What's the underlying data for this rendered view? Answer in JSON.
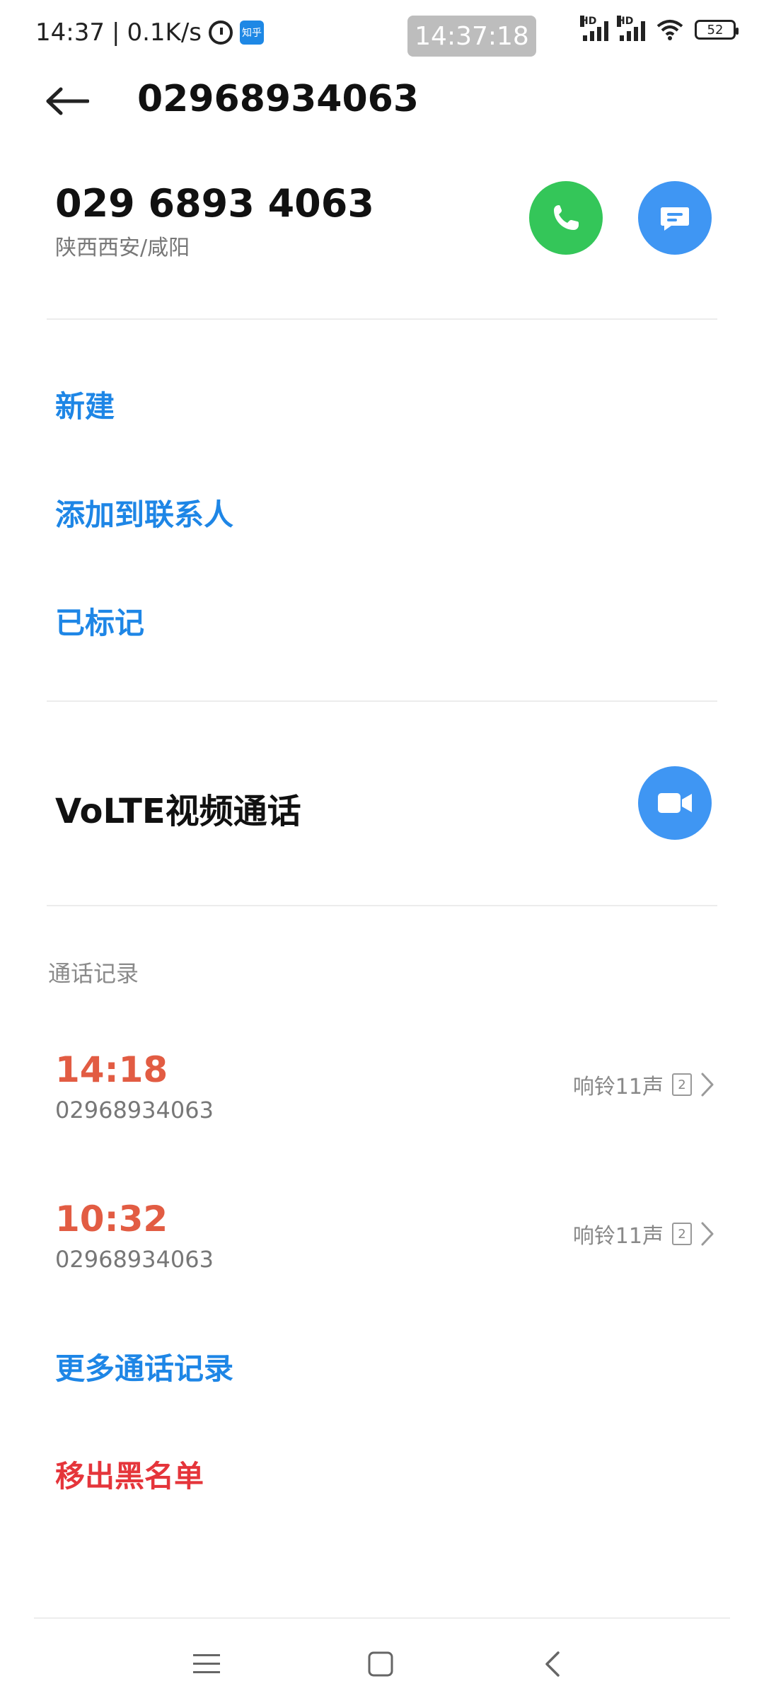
{
  "status_bar": {
    "time": "14:37",
    "network_speed": "0.1K/s",
    "clock_overlay": "14:37:18",
    "app_badge_text": "知乎",
    "battery": "52",
    "icons": [
      "alarm-icon",
      "zhihu-app-icon",
      "signal-hd-icon",
      "signal-hd-icon",
      "wifi-icon",
      "battery-icon"
    ]
  },
  "header": {
    "title": "02968934063"
  },
  "contact": {
    "formatted_number": "029 6893 4063",
    "location": "陕西西安/咸阳"
  },
  "actions": {
    "new": "新建",
    "add_to_contacts": "添加到联系人",
    "marked": "已标记"
  },
  "video_call": {
    "label": "VoLTE视频通话"
  },
  "call_log": {
    "section_title": "通话记录",
    "entries": [
      {
        "time": "14:18",
        "number": "02968934063",
        "detail": "响铃11声",
        "sim": "2"
      },
      {
        "time": "10:32",
        "number": "02968934063",
        "detail": "响铃11声",
        "sim": "2"
      }
    ],
    "more": "更多通话记录"
  },
  "blacklist": {
    "remove": "移出黑名单"
  },
  "colors": {
    "accent_blue": "#1e86e6",
    "call_green": "#34c659",
    "action_blue": "#3f96f3",
    "missed_red": "#e25c43",
    "danger_red": "#e5353b"
  }
}
